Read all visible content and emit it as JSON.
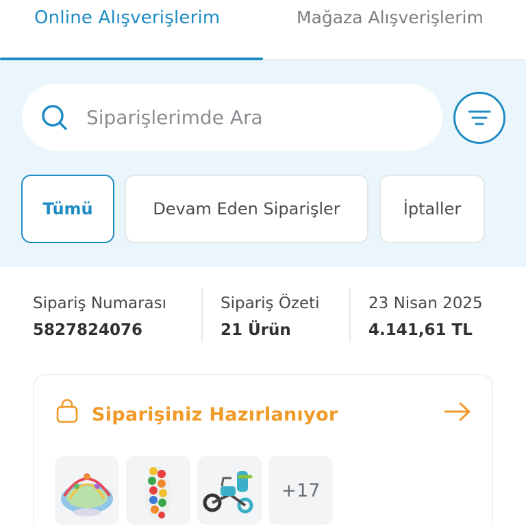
{
  "tabs": {
    "online": "Online Alışverişlerim",
    "store": "Mağaza Alışverişlerim"
  },
  "search": {
    "placeholder": "Siparişlerimde Ara"
  },
  "chips": {
    "all": "Tümü",
    "ongoing": "Devam Eden Siparişler",
    "cancelled": "İptaller"
  },
  "order": {
    "number_label": "Sipariş Numarası",
    "number_value": "5827824076",
    "summary_label": "Sipariş Özeti",
    "summary_value": "21 Ürün",
    "date": "23 Nisan 2025",
    "total": "4.141,61 TL"
  },
  "status": {
    "text": "Siparişiniz Hazırlanıyor",
    "extra_count": "+17"
  },
  "icons": {
    "search": "search-icon",
    "filter": "filter-icon",
    "bag": "shopping-bag-icon",
    "arrow": "arrow-right-icon"
  },
  "colors": {
    "accent": "#1e8bc3",
    "status": "#f09a28",
    "background_band": "#eaf6fb"
  }
}
